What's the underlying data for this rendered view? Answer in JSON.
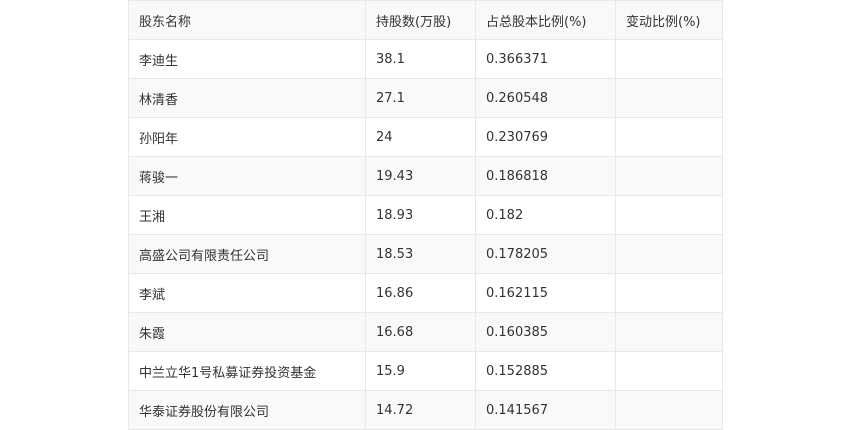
{
  "table": {
    "headers": [
      "股东名称",
      "持股数(万股)",
      "占总股本比例(%)",
      "变动比例(%)"
    ],
    "rows": [
      {
        "name": "李迪生",
        "shares": "38.1",
        "ratio": "0.366371",
        "change": ""
      },
      {
        "name": "林清香",
        "shares": "27.1",
        "ratio": "0.260548",
        "change": ""
      },
      {
        "name": "孙阳年",
        "shares": "24",
        "ratio": "0.230769",
        "change": ""
      },
      {
        "name": "蒋骏一",
        "shares": "19.43",
        "ratio": "0.186818",
        "change": ""
      },
      {
        "name": "王湘",
        "shares": "18.93",
        "ratio": "0.182",
        "change": ""
      },
      {
        "name": "高盛公司有限责任公司",
        "shares": "18.53",
        "ratio": "0.178205",
        "change": ""
      },
      {
        "name": "李斌",
        "shares": "16.86",
        "ratio": "0.162115",
        "change": ""
      },
      {
        "name": "朱霞",
        "shares": "16.68",
        "ratio": "0.160385",
        "change": ""
      },
      {
        "name": "中兰立华1号私募证券投资基金",
        "shares": "15.9",
        "ratio": "0.152885",
        "change": ""
      },
      {
        "name": "华泰证券股份有限公司",
        "shares": "14.72",
        "ratio": "0.141567",
        "change": ""
      }
    ]
  }
}
